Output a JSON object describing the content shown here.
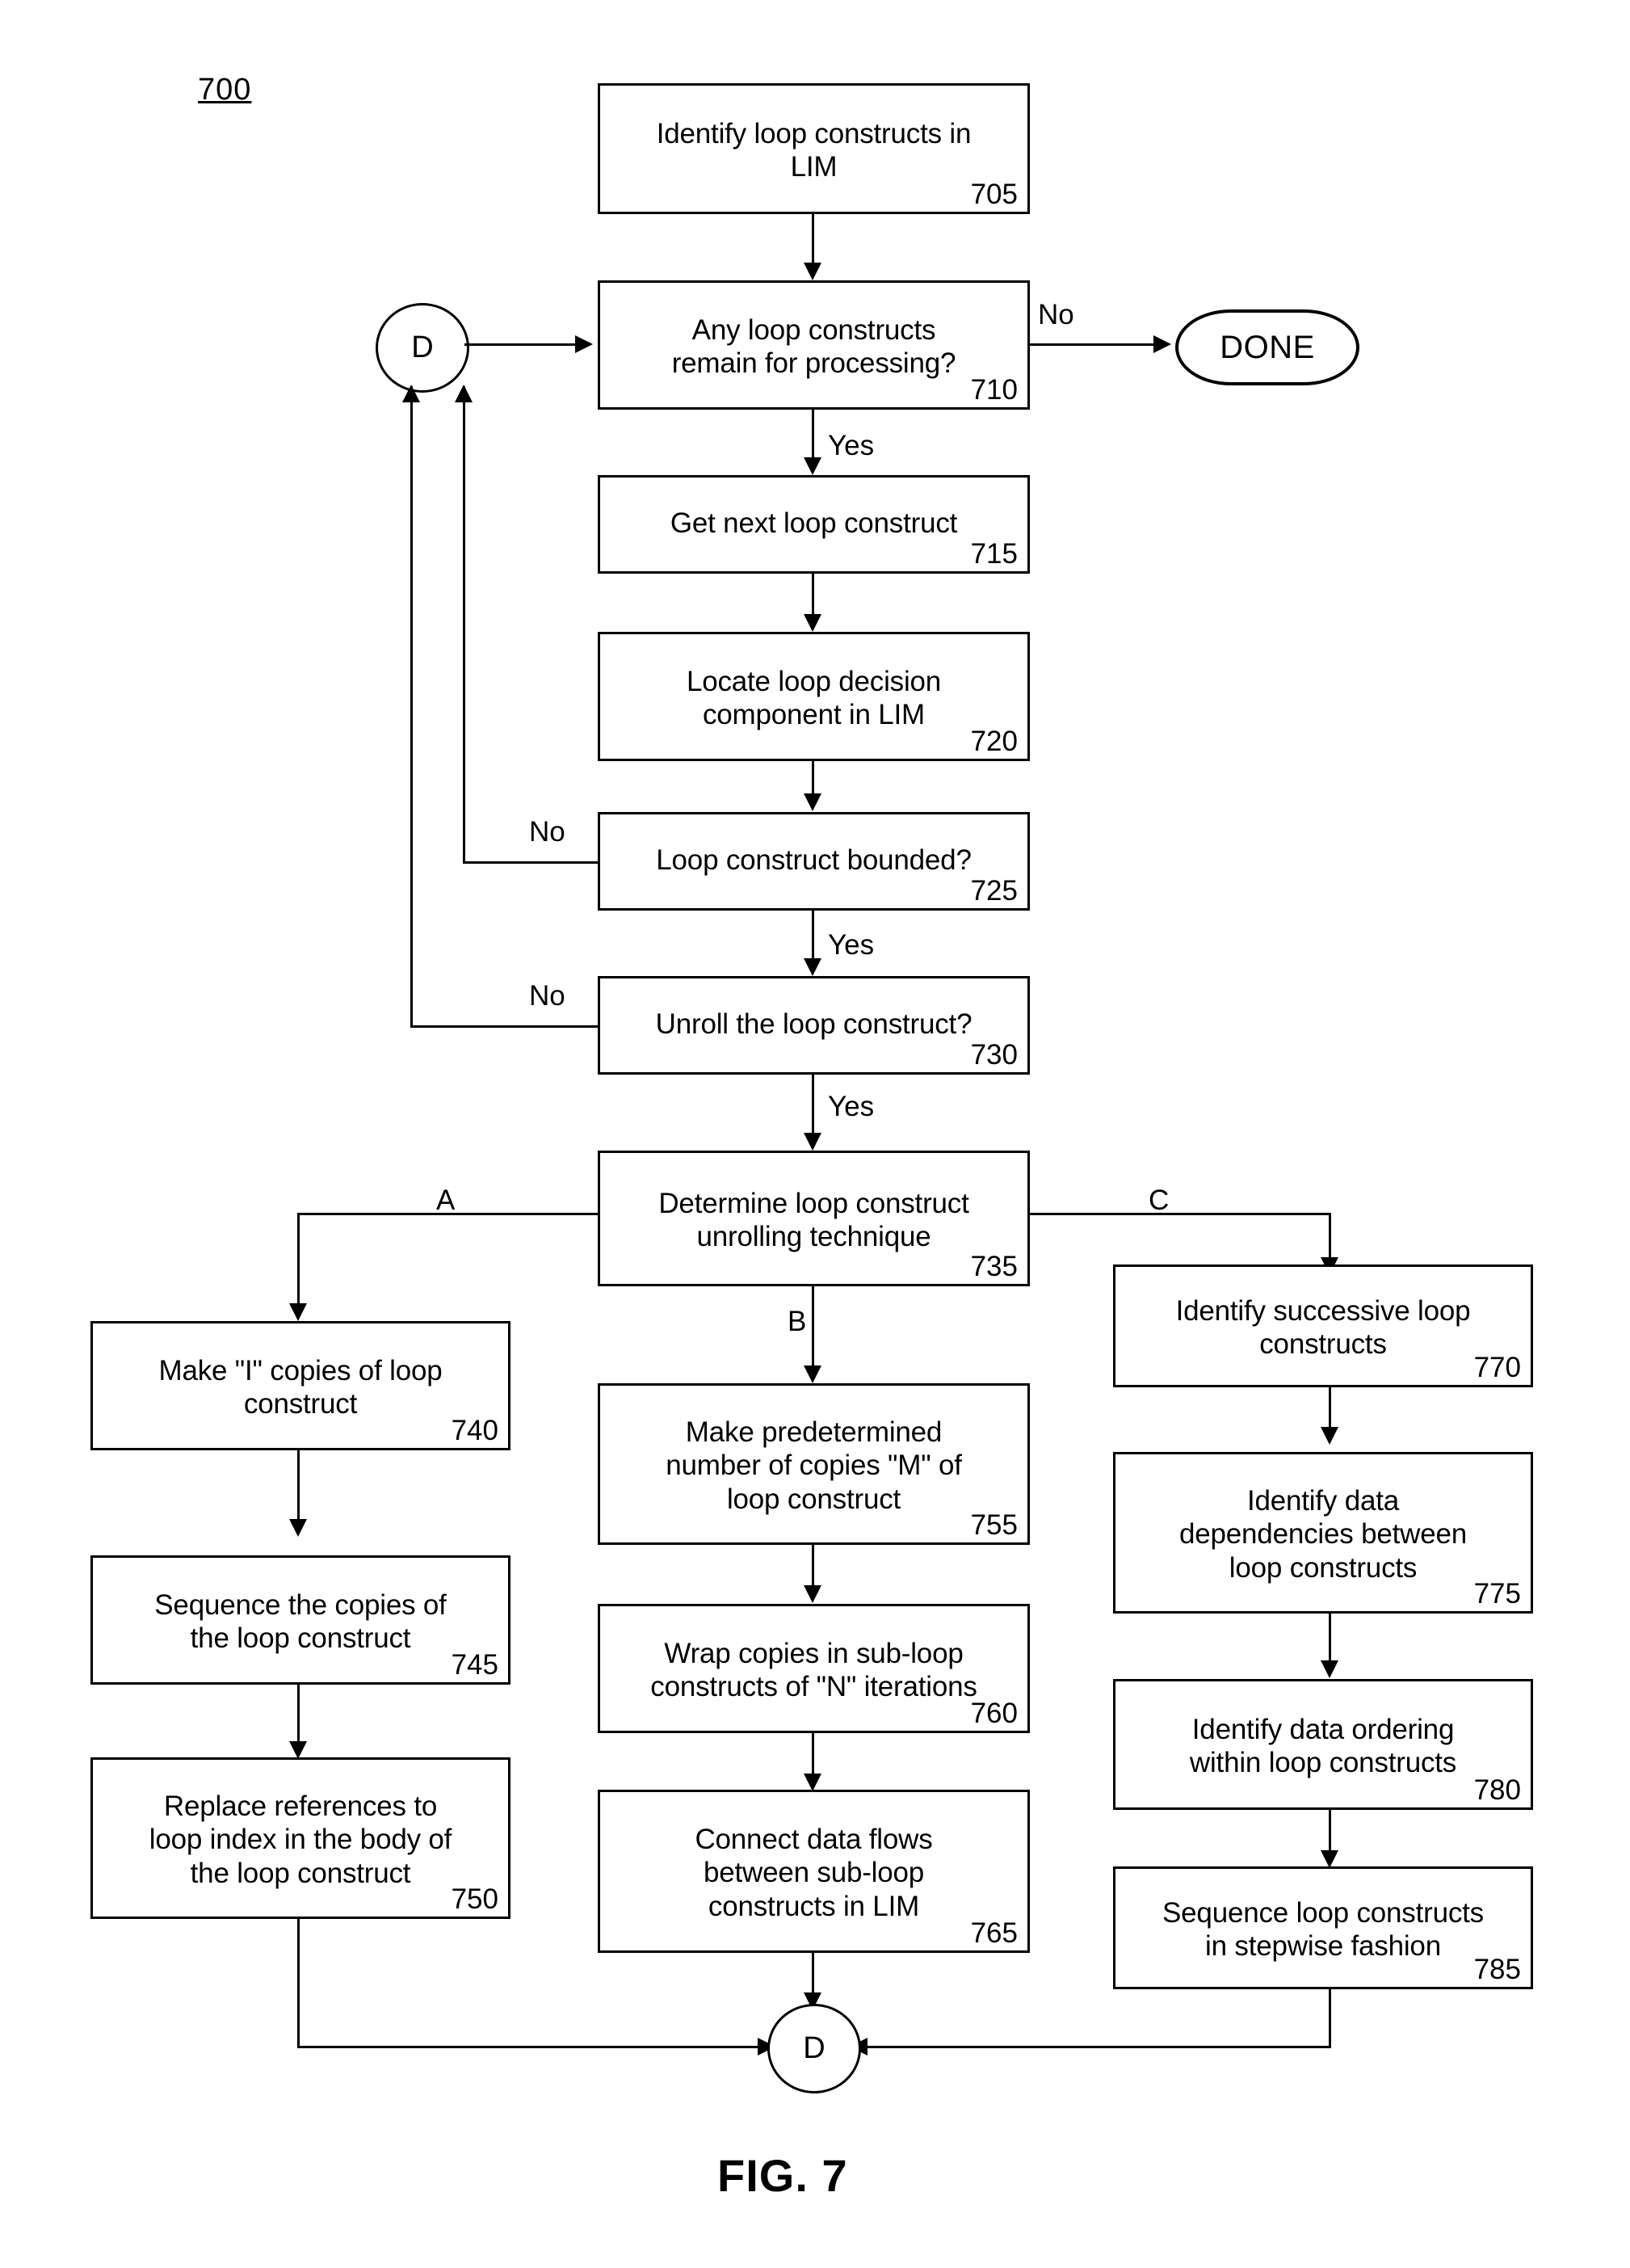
{
  "figure": {
    "reference_numeral": "700",
    "caption": "FIG. 7"
  },
  "connectors": {
    "top_label": "D",
    "bottom_label": "D"
  },
  "terminal": {
    "done_label": "DONE"
  },
  "edge_labels": {
    "no_710": "No",
    "yes_710": "Yes",
    "no_725": "No",
    "yes_725": "Yes",
    "no_730": "No",
    "yes_730": "Yes",
    "branch_a": "A",
    "branch_b": "B",
    "branch_c": "C"
  },
  "nodes": [
    {
      "id": "705",
      "text": "Identify loop constructs in\nLIM",
      "num": "705"
    },
    {
      "id": "710",
      "text": "Any loop constructs\nremain for processing?",
      "num": "710"
    },
    {
      "id": "715",
      "text": "Get next loop construct",
      "num": "715"
    },
    {
      "id": "720",
      "text": "Locate loop decision\ncomponent in LIM",
      "num": "720"
    },
    {
      "id": "725",
      "text": "Loop construct bounded?",
      "num": "725"
    },
    {
      "id": "730",
      "text": "Unroll the loop construct?",
      "num": "730"
    },
    {
      "id": "735",
      "text": "Determine loop construct\nunrolling technique",
      "num": "735"
    },
    {
      "id": "740",
      "text": "Make \"I\" copies of loop\nconstruct",
      "num": "740"
    },
    {
      "id": "745",
      "text": "Sequence the copies of\nthe loop construct",
      "num": "745"
    },
    {
      "id": "750",
      "text": "Replace references to\nloop index in the body of\nthe loop construct",
      "num": "750"
    },
    {
      "id": "755",
      "text": "Make predetermined\nnumber of copies \"M\" of\nloop construct",
      "num": "755"
    },
    {
      "id": "760",
      "text": "Wrap copies in sub-loop\nconstructs of \"N\" iterations",
      "num": "760"
    },
    {
      "id": "765",
      "text": "Connect data flows\nbetween sub-loop\nconstructs in LIM",
      "num": "765"
    },
    {
      "id": "770",
      "text": "Identify successive loop\nconstructs",
      "num": "770"
    },
    {
      "id": "775",
      "text": "Identify data\ndependencies between\nloop constructs",
      "num": "775"
    },
    {
      "id": "780",
      "text": "Identify data ordering\nwithin loop constructs",
      "num": "780"
    },
    {
      "id": "785",
      "text": "Sequence loop constructs\nin stepwise fashion",
      "num": "785"
    }
  ]
}
